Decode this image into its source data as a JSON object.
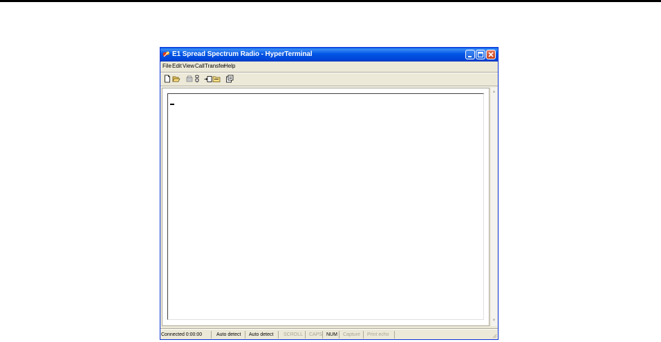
{
  "window": {
    "title": "E1 Spread Spectrum Radio - HyperTerminal",
    "controls": [
      "minimize-icon",
      "maximize-icon",
      "close-icon"
    ]
  },
  "menu": {
    "items": [
      "File",
      "Edit",
      "View",
      "Call",
      "Transfer",
      "Help"
    ]
  },
  "toolbar": {
    "icons": [
      "new-document-icon",
      "open-folder-icon",
      "call-icon",
      "disconnect-icon",
      "send-file-icon",
      "receive-file-icon",
      "properties-icon"
    ]
  },
  "terminal": {
    "content": ""
  },
  "status": {
    "connected": "Connected 0:00:00",
    "detect1": "Auto detect",
    "detect2": "Auto detect",
    "scroll": "SCROLL",
    "caps": "CAPS",
    "num": "NUM",
    "capture": "Capture",
    "print_echo": "Print echo"
  },
  "colors": {
    "title_bar": "#0055e5",
    "window_face": "#ece9d8",
    "close_button": "#c3401d"
  }
}
